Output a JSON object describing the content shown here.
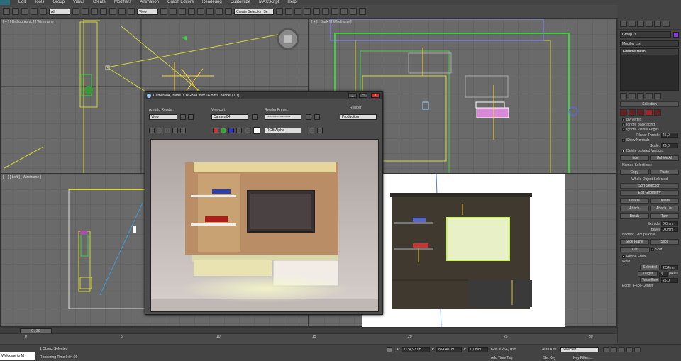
{
  "menu": [
    "Edit",
    "Tools",
    "Group",
    "Views",
    "Create",
    "Modifiers",
    "Animation",
    "Graph Editors",
    "Rendering",
    "Customize",
    "MAXScript",
    "Help"
  ],
  "toolbar": {
    "filter": "All",
    "ref_coord": "View",
    "named_sel": "Create Selection Se"
  },
  "viewports": {
    "top": "[ + ] [ Orthographic ] [ Wireframe ]",
    "front": "[ + ] [ Back ] [ Wireframe ]",
    "left": "[ + ] [ Left ] [ Wireframe ]"
  },
  "render": {
    "title": "Camera04, frame 0, RGBA Color 16 Bits/Channel (1:1)",
    "area_label": "Area to Render:",
    "area_value": "View",
    "viewport_label": "Viewport:",
    "viewport_value": "Camera04",
    "preset_label": "Render Preset:",
    "preset_value": "--------------------",
    "render_btn": "Render",
    "production": "Production",
    "channel": "RGB Alpha"
  },
  "panel": {
    "object_name": "Group13",
    "modifier_list": "Modifier List",
    "stack_item": "Editable Mesh",
    "selection": "Selection",
    "by_vertex": "By Vertex",
    "ignore_backfacing": "Ignore Backfacing",
    "ignore_visible": "Ignore Visible Edges",
    "planar_thresh": "Planar Thresh:",
    "planar_val": "45,0",
    "show_normals": "Show Normals",
    "scale_label": "Scale:",
    "scale_val": "20,0",
    "delete_isolated": "Delete Isolated Vertices",
    "hide": "Hide",
    "unhide_all": "Unhide All",
    "named_selections": "Named Selections:",
    "copy": "Copy",
    "paste": "Paste",
    "whole_object": "Whole Object Selected",
    "soft_selection": "Soft Selection",
    "edit_geometry": "Edit Geometry",
    "create": "Create",
    "delete": "Delete",
    "attach": "Attach",
    "attach_list": "Attach List",
    "break": "Break",
    "turn": "Turn",
    "extrude": "Extrude",
    "extrude_val": "0,0mm",
    "bevel": "Bevel",
    "bevel_val": "0,0mm",
    "normal": "Normal:",
    "group": "Group",
    "local": "Local",
    "slice_plane": "Slice Plane",
    "slice": "Slice",
    "cut": "Cut",
    "split": "Split",
    "refine_ends": "Refine Ends",
    "weld": "Weld",
    "selected": "Selected",
    "selected_val": "2,54mm",
    "target": "Target",
    "target_val": "4",
    "target_unit": "pixels",
    "tessellate": "Tessellate",
    "tess_val": "25,0",
    "edge": "Edge",
    "face_center": "Face-Center"
  },
  "timeline": {
    "frame": "0 / 30",
    "ticks": [
      "0",
      "5",
      "10",
      "15",
      "20",
      "25",
      "30"
    ]
  },
  "status": {
    "welcome": "Welcome to M",
    "objects": "1 Object Selected",
    "render_time": "Rendering Time 0:04:09",
    "x": "1134,931m",
    "y": "874,401m",
    "z": "0,0mm",
    "grid": "Grid = 254,0mm",
    "add_time_tag": "Add Time Tag",
    "auto_key": "Auto Key",
    "set_key": "Set Key",
    "key_mode": "Selected",
    "key_filters": "Key Filters..."
  }
}
